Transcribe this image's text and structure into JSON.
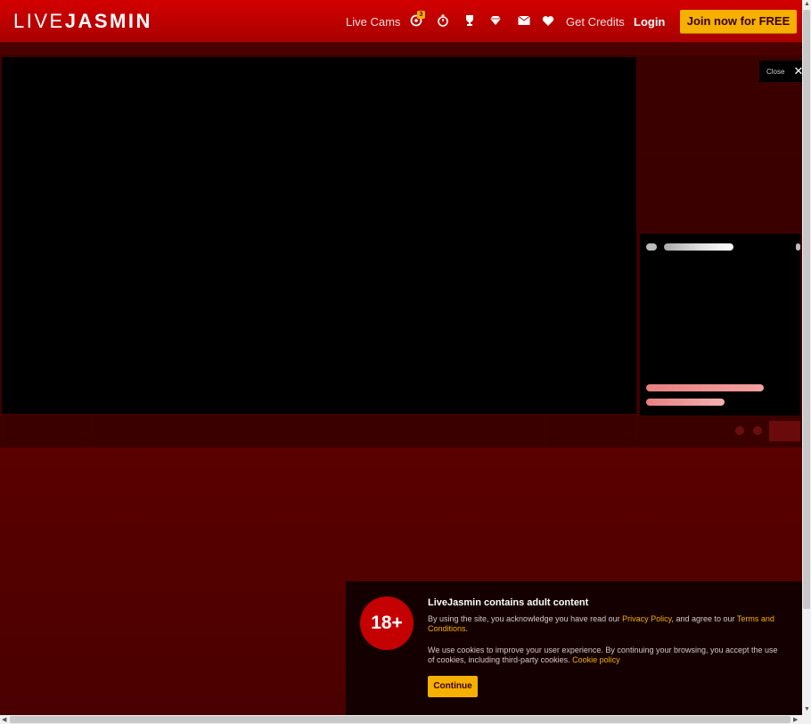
{
  "header": {
    "logo_thin": "LIVE",
    "logo_bold": "JASMIN",
    "nav_live_cams": "Live Cams",
    "notification_count": "3",
    "get_credits": "Get Credits",
    "login": "Login",
    "join": "Join now for FREE"
  },
  "player": {
    "close_label": "Close"
  },
  "overlay": {
    "age_badge": "18+",
    "title": "LiveJasmin contains adult content",
    "p1_pre": "By using the site, you acknowledge you have read our ",
    "privacy_link": "Privacy Policy",
    "p1_mid": ", and agree to our ",
    "terms_link": "Terms and Conditions",
    "p1_end": ".",
    "p2_pre": "We use cookies to improve your user experience. By continuing your browsing, you accept the use of cookies, including third-party cookies. ",
    "cookie_link": "Cookie policy",
    "continue": "Continue"
  },
  "colors": {
    "brand_red": "#c50000",
    "accent_yellow": "#f5b000"
  }
}
